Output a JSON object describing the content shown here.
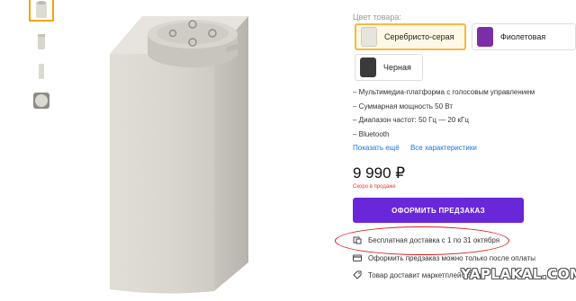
{
  "colors": {
    "accent": "#6a27d9",
    "selected_border": "#f5b942",
    "link": "#1a73e8",
    "alert": "#e0393e",
    "annotation": "#d81d1d"
  },
  "color_label": "Цвет товара:",
  "color_options": [
    {
      "label": "Серебристо-серая",
      "selected": true,
      "swatch": "#e7e4dc"
    },
    {
      "label": "Фиолетовая",
      "selected": false,
      "swatch": "#7b2ea6"
    },
    {
      "label": "Черная",
      "selected": false,
      "swatch": "#3a3a3c"
    }
  ],
  "features": [
    "– Мультимедиа-платформа с голосовым управлением",
    "– Суммарная мощность 50 Вт",
    "– Диапазон частот: 50 Гц — 20 кГц",
    "– Bluetooth"
  ],
  "links": {
    "show_more": "Показать ещё",
    "all_specs": "Все характеристики"
  },
  "price": "9 990 ₽",
  "availability": "Скоро в продаже",
  "order_button": "ОФОРМИТЬ ПРЕДЗАКАЗ",
  "info": {
    "delivery": "Бесплатная доставка с 1 по 31 октября",
    "payment": "Оформить предзаказ можно только после оплаты",
    "courier": "Товар доставит маркетплейс Беру"
  },
  "watermark": "YAPLAKAL.COM"
}
